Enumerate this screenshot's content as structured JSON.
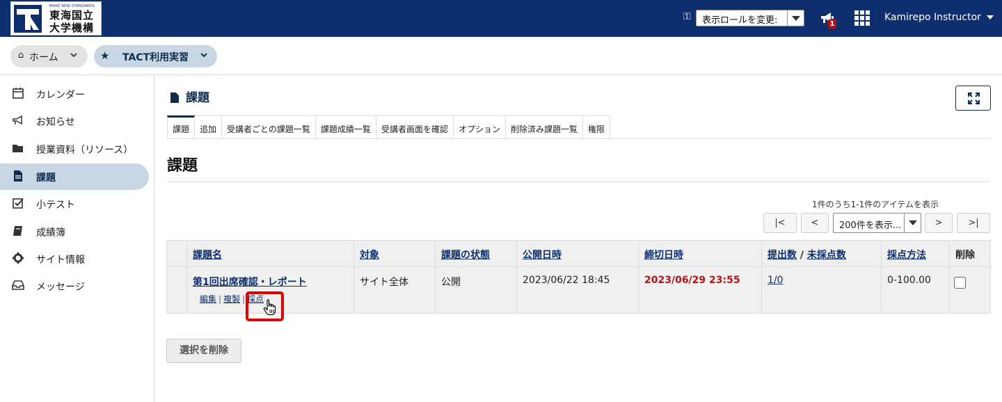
{
  "header": {
    "logo_small": "MAKE NEW STANDARDS.",
    "logo_line1": "東海国立",
    "logo_line2": "大学機構",
    "role_select": "表示ロールを変更:",
    "notification_count": "1",
    "user_name": "Kamirepo Instructor"
  },
  "breadcrumb": {
    "home": "ホーム",
    "site": "TACT利用実習"
  },
  "sidebar": {
    "items": [
      {
        "label": "カレンダー",
        "icon": "calendar-icon"
      },
      {
        "label": "お知らせ",
        "icon": "megaphone-icon"
      },
      {
        "label": "授業資料（リソース）",
        "icon": "folder-icon"
      },
      {
        "label": "課題",
        "icon": "document-icon",
        "active": true
      },
      {
        "label": "小テスト",
        "icon": "checkbox-icon"
      },
      {
        "label": "成績簿",
        "icon": "book-icon"
      },
      {
        "label": "サイト情報",
        "icon": "gear-icon"
      },
      {
        "label": "メッセージ",
        "icon": "inbox-icon"
      }
    ]
  },
  "tool": {
    "title": "課題",
    "heading": "課題",
    "tabs": [
      "課題",
      "追加",
      "受講者ごとの課題一覧",
      "課題成績一覧",
      "受講者画面を確認",
      "オプション",
      "削除済み課題一覧",
      "権限"
    ]
  },
  "pager": {
    "count_text": "1件のうち1-1件のアイテムを表示",
    "first": "|<",
    "prev": "<",
    "page_size": "200件を表示...",
    "next": ">",
    "last": ">|"
  },
  "table": {
    "headers": {
      "title": "課題名",
      "target": "対象",
      "status": "課題の状態",
      "open": "公開日時",
      "due": "締切日時",
      "submissions": "提出数",
      "separator": "/",
      "ungraded": "未採点数",
      "scale": "採点方法",
      "remove": "削除"
    },
    "rows": [
      {
        "title": "第1回出席確認・レポート",
        "edit": "編集",
        "duplicate": "複製",
        "grade": "採点",
        "target": "サイト全体",
        "status": "公開",
        "open": "2023/06/22 18:45",
        "due": "2023/06/29 23:55",
        "submissions": "1/0",
        "scale": "0-100.00"
      }
    ]
  },
  "actions": {
    "delete_selected": "選択を削除"
  },
  "colors": {
    "brand": "#0f2e6e",
    "active_bg": "#c8d7e3",
    "due_red": "#b01414",
    "highlight": "#e00000"
  }
}
